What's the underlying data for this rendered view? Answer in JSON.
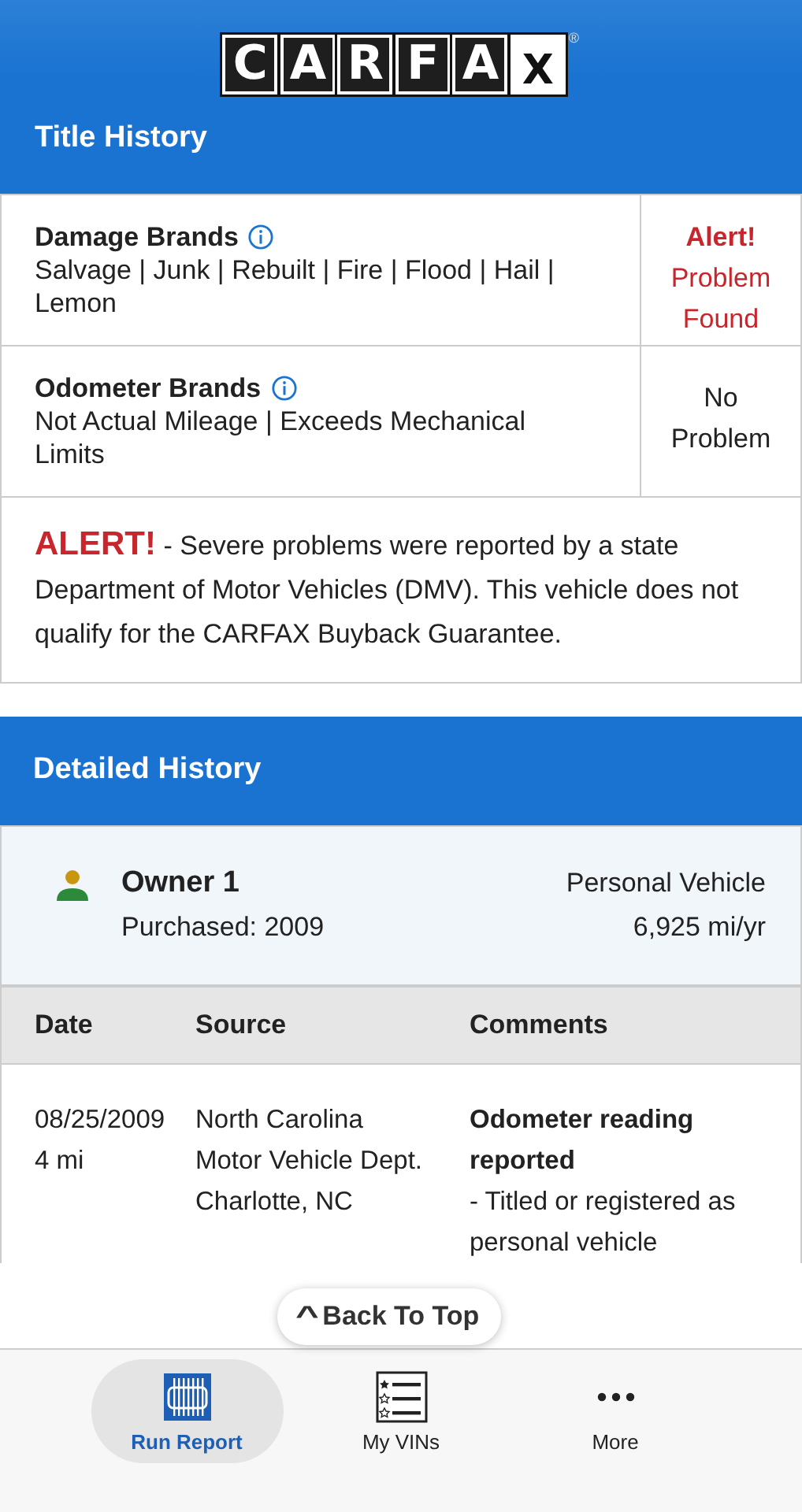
{
  "header": {
    "logo_letters": [
      "C",
      "A",
      "R",
      "F",
      "A",
      "X"
    ],
    "registered": "®"
  },
  "title_history": {
    "title": "Title History",
    "rows": [
      {
        "label": "Damage Brands",
        "info": true,
        "detail": "Salvage | Junk | Rebuilt | Fire | Flood | Hail | Lemon",
        "status_lines": [
          "Alert!",
          "Problem Found"
        ],
        "alert": true
      },
      {
        "label": "Odometer Brands",
        "info": true,
        "detail": "Not Actual Mileage | Exceeds Mechanical Limits",
        "status_lines": [
          "No Problem"
        ],
        "alert": false
      }
    ],
    "alert": {
      "tag": "ALERT!",
      "text": " - Severe problems were reported by a state Department of Motor Vehicles (DMV). This vehicle does not qualify for the CARFAX Buyback Guarantee."
    }
  },
  "detailed_history": {
    "title": "Detailed History",
    "owner": {
      "name": "Owner 1",
      "purchased": "Purchased: 2009",
      "use": "Personal Vehicle",
      "mileage": "6,925 mi/yr"
    },
    "columns": [
      "Date",
      "Source",
      "Comments"
    ],
    "rows": [
      {
        "date": "08/25/2009",
        "odometer": "4 mi",
        "source": "North Carolina Motor Vehicle Dept. Charlotte, NC",
        "comment_title": "Odometer reading reported",
        "comment": "- Titled or registered as personal vehicle"
      }
    ]
  },
  "back_to_top": {
    "icon": "^",
    "label": "Back To Top"
  },
  "tab_bar": [
    {
      "kind": "report",
      "label": "Run Report",
      "selected": true
    },
    {
      "kind": "list",
      "label": "My VINs",
      "selected": false
    },
    {
      "kind": "more",
      "label": "More",
      "selected": false
    }
  ]
}
